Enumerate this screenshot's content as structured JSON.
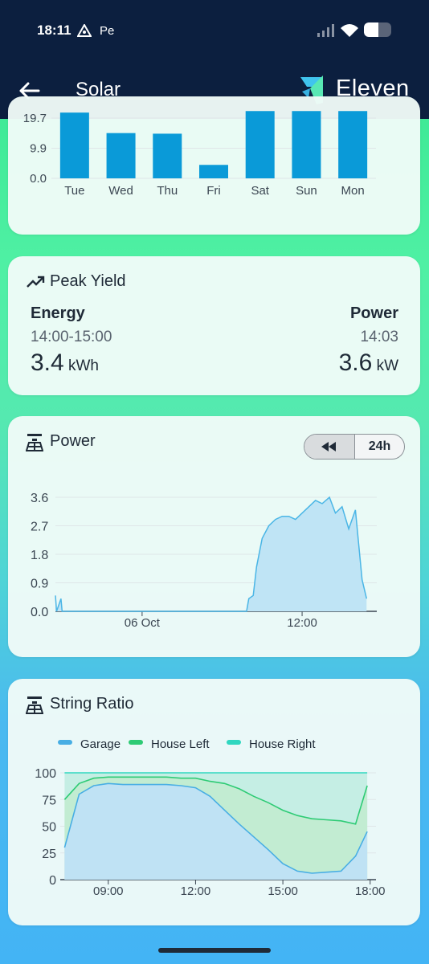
{
  "status_bar": {
    "time": "18:11",
    "carrier": "Pe"
  },
  "app_bar": {
    "title": "Solar",
    "brand": "Eleven",
    "back_icon": "arrow-left-icon",
    "logo_icon": "eleven-logo-icon"
  },
  "weekly_yield": {
    "chart_data": {
      "type": "bar",
      "categories": [
        "Tue",
        "Wed",
        "Thu",
        "Fri",
        "Sat",
        "Sun",
        "Mon"
      ],
      "values": [
        21.5,
        14.8,
        14.6,
        4.4,
        22.0,
        22.0,
        22.0
      ],
      "y_ticks": [
        "19.7",
        "9.9",
        "0.0"
      ],
      "ylim": [
        0,
        19.7
      ],
      "bar_color": "#0a9ad8",
      "grid": true
    }
  },
  "peak_yield": {
    "title": "Peak Yield",
    "icon": "trending-up-icon",
    "energy": {
      "label": "Energy",
      "time": "14:00-15:00",
      "value": "3.4",
      "unit": "kWh"
    },
    "power": {
      "label": "Power",
      "time": "14:03",
      "value": "3.6",
      "unit": "kW"
    }
  },
  "power_chart": {
    "title": "Power",
    "icon": "solar-panel-icon",
    "rewind_icon": "rewind-icon",
    "range_label": "24h",
    "chart_data": {
      "type": "area",
      "x_ticks": [
        "06 Oct",
        "12:00"
      ],
      "y_ticks": [
        "3.6",
        "2.7",
        "1.8",
        "0.9",
        "0.0"
      ],
      "ylim": [
        0,
        3.6
      ],
      "x": [
        "17:35",
        "17:55",
        "18:00",
        "06:00",
        "07:50",
        "08:00",
        "08:20",
        "08:35",
        "09:00",
        "09:30",
        "10:00",
        "10:30",
        "11:00",
        "11:30",
        "12:00",
        "12:30",
        "13:00",
        "13:30",
        "14:03",
        "14:30",
        "15:00",
        "15:30",
        "16:00",
        "16:30",
        "16:50",
        "17:30"
      ],
      "values": [
        0.0,
        0.4,
        0.0,
        0.0,
        0.0,
        0.4,
        0.5,
        1.4,
        2.3,
        2.7,
        2.9,
        3.0,
        3.0,
        2.9,
        3.1,
        3.3,
        3.5,
        3.4,
        3.6,
        3.1,
        3.3,
        2.6,
        3.2,
        1.0,
        0.4,
        0.5
      ],
      "line_color": "#4bb6e6",
      "fill_color": "#bfe4f5",
      "grid": true
    }
  },
  "string_ratio": {
    "title": "String Ratio",
    "icon": "solar-panel-icon",
    "legend": [
      {
        "name": "Garage",
        "color": "#48aee4"
      },
      {
        "name": "House Left",
        "color": "#2ecb75"
      },
      {
        "name": "House Right",
        "color": "#30d7c0"
      }
    ],
    "chart_data": {
      "type": "area",
      "x_ticks": [
        "09:00",
        "12:00",
        "15:00",
        "18:00"
      ],
      "y_ticks": [
        "100",
        "75",
        "50",
        "25",
        "0"
      ],
      "ylim": [
        0,
        100
      ],
      "x_hours": [
        7.5,
        8.0,
        8.5,
        9.0,
        9.5,
        10.0,
        10.5,
        11.0,
        11.5,
        12.0,
        12.5,
        13.0,
        13.5,
        14.0,
        14.5,
        15.0,
        15.5,
        16.0,
        16.5,
        17.0,
        17.5,
        17.9
      ],
      "series": [
        {
          "name": "Garage",
          "values": [
            30,
            80,
            88,
            90,
            89,
            89,
            89,
            89,
            88,
            86,
            78,
            65,
            52,
            40,
            28,
            15,
            8,
            6,
            7,
            8,
            22,
            45
          ]
        },
        {
          "name": "House Left",
          "values": [
            75,
            90,
            95,
            96,
            96,
            96,
            96,
            96,
            95,
            95,
            92,
            90,
            85,
            78,
            72,
            65,
            60,
            57,
            56,
            55,
            52,
            88
          ]
        },
        {
          "name": "House Right",
          "values": [
            100,
            100,
            100,
            100,
            100,
            100,
            100,
            100,
            100,
            100,
            100,
            100,
            100,
            100,
            100,
            100,
            100,
            100,
            100,
            100,
            100,
            100
          ]
        }
      ]
    }
  }
}
